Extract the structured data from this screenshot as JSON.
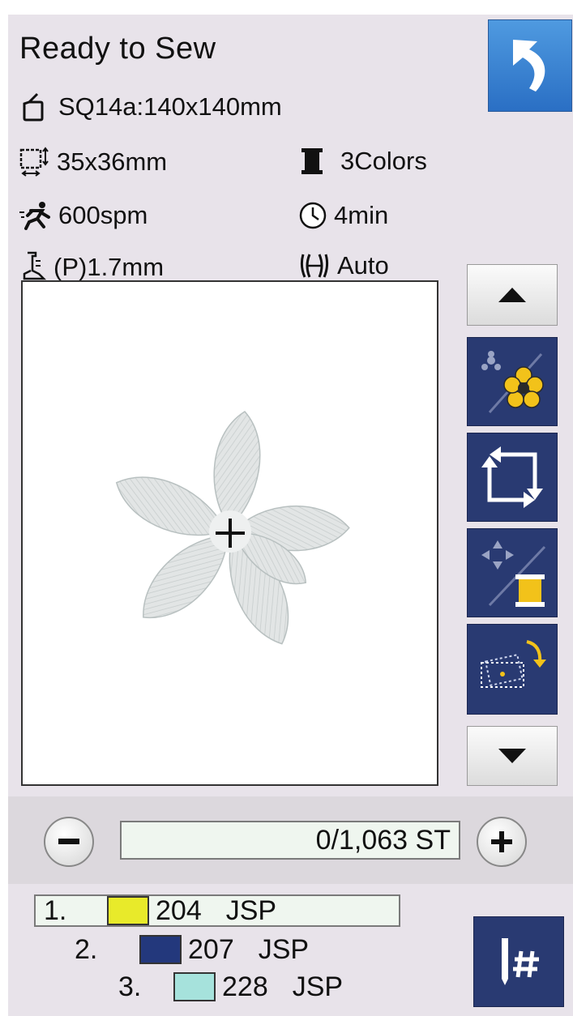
{
  "header": {
    "title": "Ready to Sew"
  },
  "info": {
    "hoop": "SQ14a:140x140mm",
    "size": "35x36mm",
    "colors": "3Colors",
    "speed": "600spm",
    "time": "4min",
    "foot_height": "(P)1.7mm",
    "thread_cut": "Auto"
  },
  "stitch": {
    "counter": "0/1,063 ST"
  },
  "color_list": [
    {
      "index": "1.",
      "color": "#e8ea2a",
      "code": "204",
      "brand": "JSP"
    },
    {
      "index": "2.",
      "color": "#23387c",
      "code": "207",
      "brand": "JSP"
    },
    {
      "index": "3.",
      "color": "#a6e2dc",
      "code": "228",
      "brand": "JSP"
    }
  ],
  "icons": {
    "back": "return-icon",
    "hoop": "hoop-icon",
    "size": "design-size-icon",
    "colors": "thread-spool-icon",
    "speed": "runner-icon",
    "time": "clock-icon",
    "foot": "presser-foot-icon",
    "cut": "thread-cut-icon",
    "needle": "needle-number-icon"
  }
}
